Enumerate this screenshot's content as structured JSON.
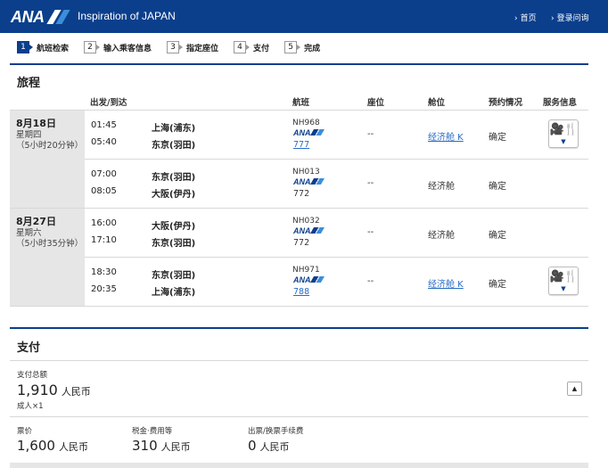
{
  "header": {
    "logo_text": "ANA",
    "tagline": "Inspiration of JAPAN",
    "links": [
      "首页",
      "登录问询"
    ],
    "colors": {
      "brand": "#0b3f8c",
      "accent": "#3d8ed8",
      "link": "#2a6cc4"
    }
  },
  "steps": [
    {
      "num": "1",
      "label": "航班检索",
      "active": true
    },
    {
      "num": "2",
      "label": "输入乘客信息",
      "active": false
    },
    {
      "num": "3",
      "label": "指定座位",
      "active": false
    },
    {
      "num": "4",
      "label": "支付",
      "active": false
    },
    {
      "num": "5",
      "label": "完成",
      "active": false
    }
  ],
  "itinerary": {
    "title": "旅程",
    "columns": {
      "route": "出发/到达",
      "flight": "航班",
      "seat": "座位",
      "cabin": "舱位",
      "status": "预约情况",
      "service": "服务信息"
    },
    "days": [
      {
        "date": "8月18日",
        "weekday": "星期四",
        "duration": "（5小时20分钟）"
      },
      {
        "date": "8月27日",
        "weekday": "星期六",
        "duration": "（5小时35分钟）"
      }
    ],
    "segments": [
      {
        "dep_time": "01:45",
        "arr_time": "05:40",
        "dep_city": "上海(浦东)",
        "arr_city": "东京(羽田)",
        "flight": "NH968",
        "aircraft": "777",
        "aircraft_link": true,
        "seat": "--",
        "cabin": "经济舱 K",
        "cabin_link": true,
        "status": "确定",
        "service": true
      },
      {
        "dep_time": "07:00",
        "arr_time": "08:05",
        "dep_city": "东京(羽田)",
        "arr_city": "大阪(伊丹)",
        "flight": "NH013",
        "aircraft": "772",
        "aircraft_link": false,
        "seat": "--",
        "cabin": "经济舱",
        "cabin_link": false,
        "status": "确定",
        "service": false
      },
      {
        "dep_time": "16:00",
        "arr_time": "17:10",
        "dep_city": "大阪(伊丹)",
        "arr_city": "东京(羽田)",
        "flight": "NH032",
        "aircraft": "772",
        "aircraft_link": false,
        "seat": "--",
        "cabin": "经济舱",
        "cabin_link": false,
        "status": "确定",
        "service": false
      },
      {
        "dep_time": "18:30",
        "arr_time": "20:35",
        "dep_city": "东京(羽田)",
        "arr_city": "上海(浦东)",
        "flight": "NH971",
        "aircraft": "788",
        "aircraft_link": true,
        "seat": "--",
        "cabin": "经济舱 K",
        "cabin_link": true,
        "status": "确定",
        "service": true
      }
    ],
    "service_icon": "movie-and-meal-icon"
  },
  "payment": {
    "title": "支付",
    "total_label": "支付总额",
    "total_value": "1,910",
    "currency": "人民币",
    "passengers": "成人×1",
    "fare_label": "票价",
    "fare_value": "1,600",
    "tax_label": "税金·费用等",
    "tax_value": "310",
    "fee_label": "出票/换票手续费",
    "fee_value": "0"
  }
}
